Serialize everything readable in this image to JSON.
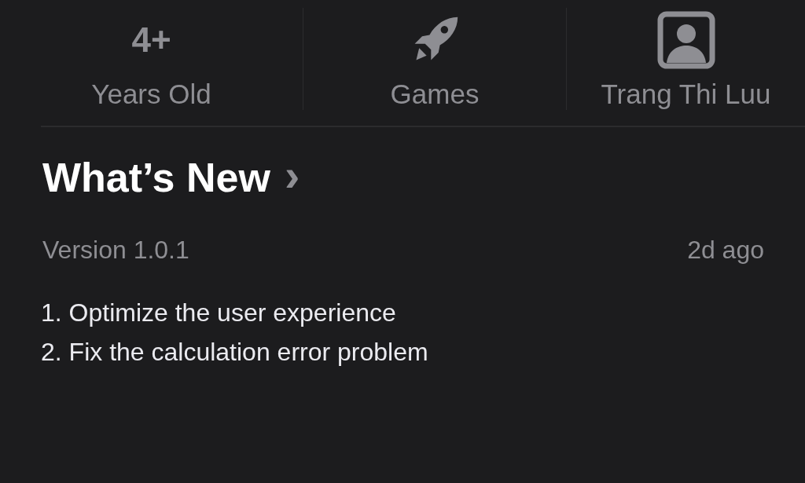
{
  "info": [
    {
      "kind": "rating",
      "value": "4+",
      "label": "Years Old"
    },
    {
      "kind": "category",
      "label": "Games"
    },
    {
      "kind": "developer",
      "label": "Trang Thi Luu"
    }
  ],
  "whats_new": {
    "title": "What’s New",
    "chevron": "›",
    "version": "Version 1.0.1",
    "date": "2d ago",
    "notes": [
      "1. Optimize the user experience",
      "2. Fix the calculation error problem"
    ]
  }
}
